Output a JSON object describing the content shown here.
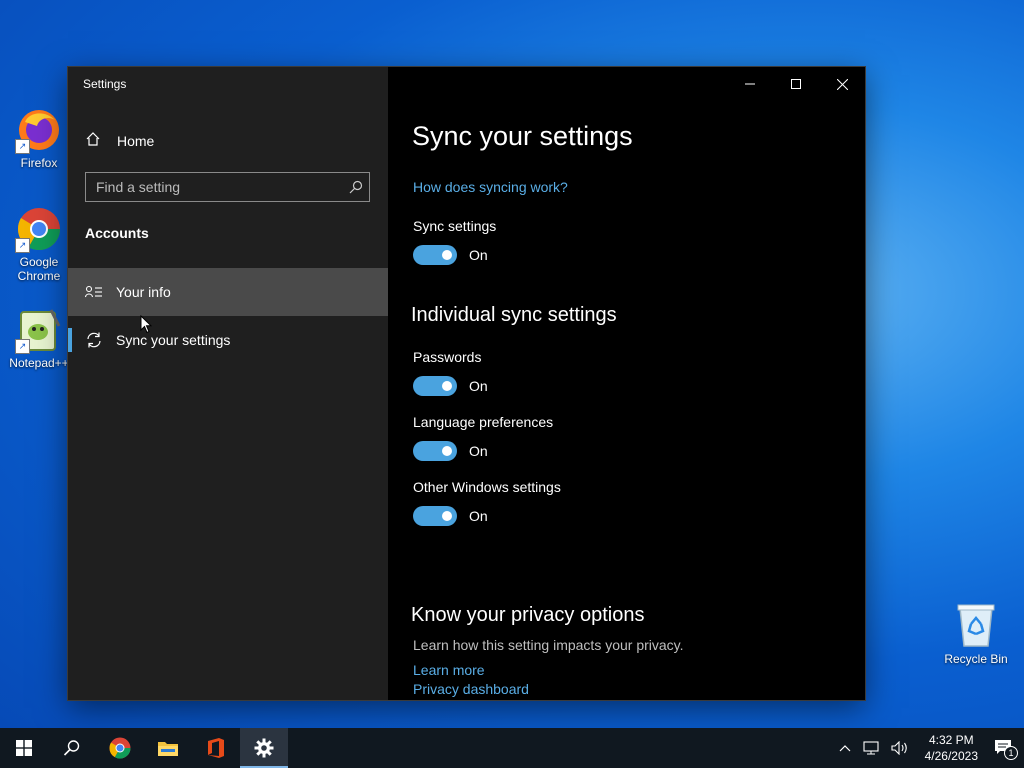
{
  "desktop": {
    "icons": [
      {
        "label": "Firefox"
      },
      {
        "label": "Google Chrome"
      },
      {
        "label": "Notepad++"
      },
      {
        "label": "Recycle Bin"
      }
    ]
  },
  "window": {
    "title": "Settings",
    "sidebar": {
      "home_label": "Home",
      "search_placeholder": "Find a setting",
      "section_title": "Accounts",
      "items": [
        {
          "label": "Your info",
          "icon": "person-list-icon"
        },
        {
          "label": "Sync your settings",
          "icon": "sync-icon"
        }
      ]
    },
    "content": {
      "title": "Sync your settings",
      "help_link": "How does syncing work?",
      "sync_settings": {
        "label": "Sync settings",
        "state": "On"
      },
      "individual_heading": "Individual sync settings",
      "toggles": [
        {
          "label": "Passwords",
          "state": "On"
        },
        {
          "label": "Language preferences",
          "state": "On"
        },
        {
          "label": "Other Windows settings",
          "state": "On"
        }
      ],
      "privacy": {
        "heading": "Know your privacy options",
        "description": "Learn how this setting impacts your privacy.",
        "learn_more": "Learn more",
        "dashboard": "Privacy dashboard"
      }
    }
  },
  "taskbar": {
    "time": "4:32 PM",
    "date": "4/26/2023",
    "notification_count": "1"
  },
  "colors": {
    "accent": "#4aa3df",
    "link": "#5aaee6",
    "sidebar_bg": "#1f1f1f",
    "content_bg": "#000000"
  }
}
